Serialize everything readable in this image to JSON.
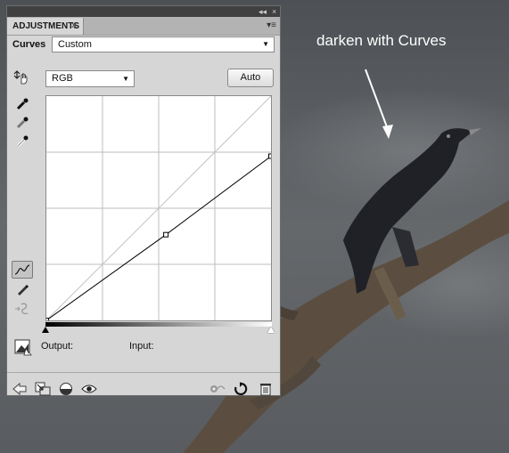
{
  "annotation": "darken with Curves",
  "panel": {
    "tab_title": "ADJUSTMENTS",
    "tab_close": "×",
    "collapse_glyph": "◂◂",
    "close_glyph": "×",
    "menu_glyph": "▾≡",
    "adjustment_label": "Curves",
    "preset_value": "Custom",
    "channel_value": "RGB",
    "auto_button": "Auto",
    "output_label": "Output:",
    "input_label": "Input:"
  },
  "curve": {
    "points": [
      [
        0,
        0
      ],
      [
        0.532,
        0.382
      ],
      [
        1,
        0.732
      ]
    ],
    "selected_point": 1
  },
  "colors": {
    "panel_bg": "#d6d6d6",
    "graph_bg": "#ffffff",
    "grid": "#bdbdbd",
    "curve": "#000000"
  }
}
